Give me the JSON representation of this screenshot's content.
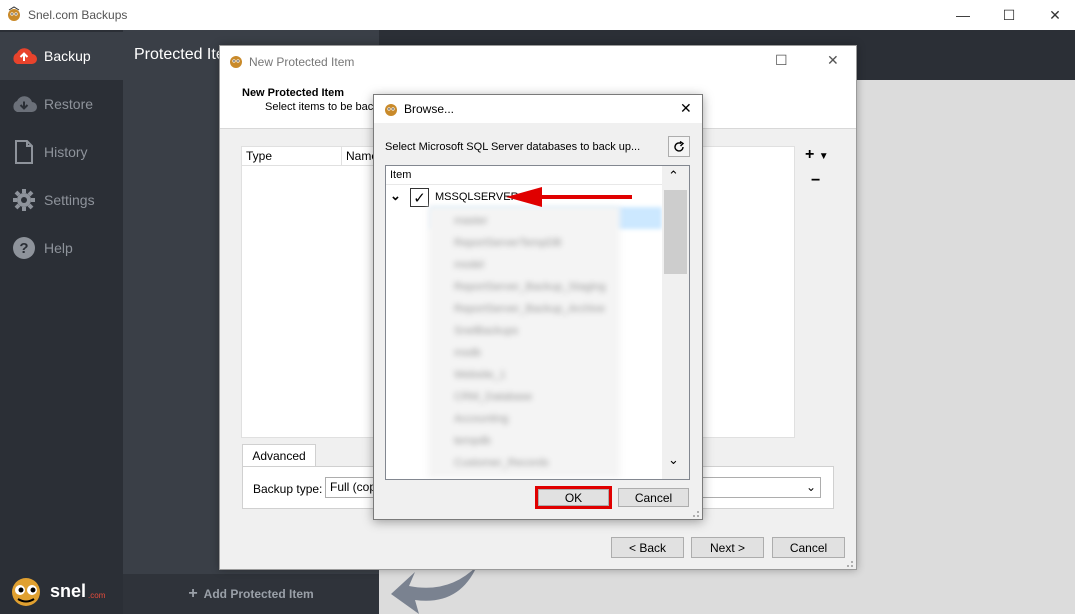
{
  "main_window": {
    "title": "Snel.com Backups",
    "controls": {
      "minimize": "—",
      "maximize": "☐",
      "close": "✕"
    }
  },
  "sidebar": {
    "items": [
      {
        "label": "Backup",
        "icon": "cloud-upload-icon",
        "active": true
      },
      {
        "label": "Restore",
        "icon": "cloud-download-icon",
        "active": false
      },
      {
        "label": "History",
        "icon": "document-icon",
        "active": false
      },
      {
        "label": "Settings",
        "icon": "gear-icon",
        "active": false
      },
      {
        "label": "Help",
        "icon": "help-icon",
        "active": false
      }
    ],
    "brand": {
      "word": "snel",
      "suffix": ".com"
    }
  },
  "panel": {
    "title": "Protected Ite",
    "add_button": "Add Protected Item",
    "add_icon": "+"
  },
  "new_item_dialog": {
    "title": "New Protected Item",
    "heading": "New Protected Item",
    "subheading": "Select items to be bac",
    "columns": [
      "Type",
      "Name"
    ],
    "add_symbol": "+",
    "remove_symbol": "−",
    "tab": "Advanced",
    "backup_type_label": "Backup type:",
    "backup_type_value": "Full (cop",
    "buttons": {
      "back": "< Back",
      "next": "Next >",
      "cancel": "Cancel"
    }
  },
  "browse_dialog": {
    "title": "Browse...",
    "instruction": "Select Microsoft SQL Server databases to back up...",
    "column": "Item",
    "root_item": "MSSQLSERVER",
    "root_checked": true,
    "child_items": [
      "master",
      "ReportServerTempDB",
      "model",
      "ReportServer_Backup_Staging",
      "ReportServer_Backup_Archive",
      "SnelBackups",
      "msdb",
      "Website_1",
      "CRM_Database",
      "Accounting",
      "tempdb",
      "Customer_Records"
    ],
    "buttons": {
      "ok": "OK",
      "cancel": "Cancel"
    }
  },
  "colors": {
    "sidebar": "#2b2f36",
    "panel": "#3a3f47",
    "highlight": "#e00000",
    "selection": "#cce8ff"
  }
}
